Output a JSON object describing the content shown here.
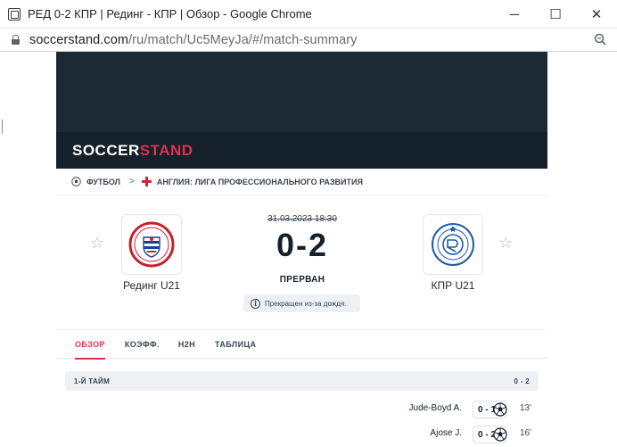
{
  "window": {
    "title": "РЕД 0-2 КПР | Рединг - КПР | Обзор - Google Chrome",
    "minimize": "─",
    "maximize": "☐",
    "close": "✕"
  },
  "address": {
    "domain": "soccerstand.com",
    "path": "/ru/match/Uc5MeyJa/#/match-summary"
  },
  "site": {
    "logo_part1": "SOCCER",
    "logo_part2": "STAND",
    "brand_color": "#e0314b"
  },
  "breadcrumb": {
    "sport": "ФУТБОЛ",
    "chevron": ">",
    "league": "АНГЛИЯ: ЛИГА ПРОФЕССИОНАЛЬНОГО РАЗВИТИЯ"
  },
  "match": {
    "date": "31.03.2023 18:30",
    "score": "0-2",
    "status": "ПРЕРВАН",
    "info_icon": "i",
    "info": "Прекращен из-за дождя.",
    "home": {
      "name": "Рединг U21",
      "star": "☆"
    },
    "away": {
      "name": "КПР U21",
      "star": "☆"
    }
  },
  "tabs": [
    {
      "label": "ОБЗОР",
      "active": true
    },
    {
      "label": "КОЭФФ."
    },
    {
      "label": "H2H"
    },
    {
      "label": "ТАБЛИЦА"
    }
  ],
  "summary": {
    "period_label": "1-Й ТАЙМ",
    "period_score": "0 - 2",
    "events": [
      {
        "player": "Jude-Boyd A.",
        "score": "0 - 1",
        "minute": "13'"
      },
      {
        "player": "Ajose J.",
        "score": "0 - 2",
        "minute": "16'"
      }
    ]
  }
}
